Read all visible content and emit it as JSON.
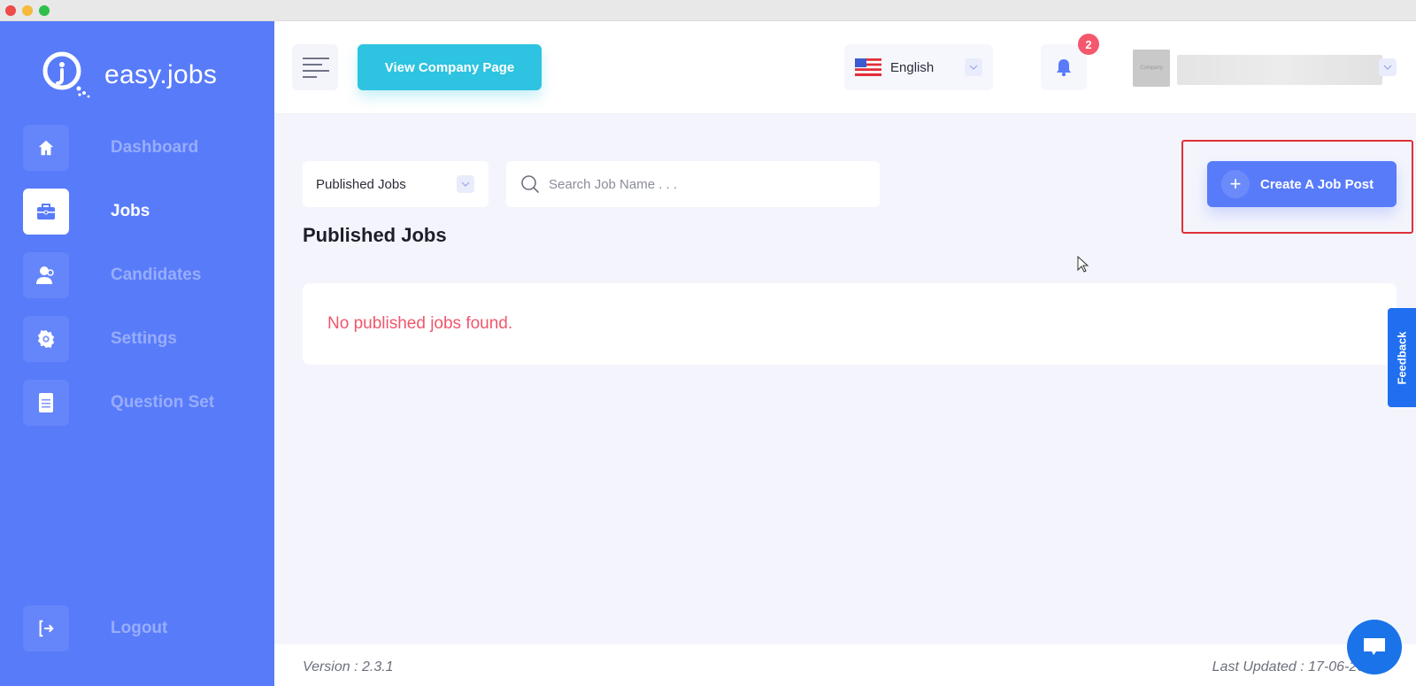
{
  "app": {
    "brand": "easy.jobs"
  },
  "sidebar": {
    "items": [
      {
        "label": "Dashboard",
        "icon": "home-icon",
        "active": false
      },
      {
        "label": "Jobs",
        "icon": "briefcase-icon",
        "active": true
      },
      {
        "label": "Candidates",
        "icon": "users-icon",
        "active": false
      },
      {
        "label": "Settings",
        "icon": "gear-icon",
        "active": false
      },
      {
        "label": "Question Set",
        "icon": "document-icon",
        "active": false
      }
    ],
    "logout": {
      "label": "Logout",
      "icon": "logout-icon"
    }
  },
  "topbar": {
    "view_company_label": "View Company Page",
    "language": {
      "selected": "English",
      "flag": "us-flag-icon"
    },
    "notifications": {
      "count": "2"
    },
    "user": {
      "avatar_text": "Company",
      "name": ""
    }
  },
  "filters": {
    "status_selected": "Published Jobs",
    "search_placeholder": "Search Job Name . . .",
    "search_value": ""
  },
  "main": {
    "title": "Published Jobs",
    "create_button_label": "Create A Job Post",
    "empty_message": "No published jobs found."
  },
  "feedback_label": "Feedback",
  "footer": {
    "version": "Version : 2.3.1",
    "last_updated": "Last Updated : 17-06-2020"
  },
  "colors": {
    "brand": "#587bfa",
    "accent": "#2ec3e0",
    "error": "#f0566c",
    "highlight": "#e0303a"
  }
}
